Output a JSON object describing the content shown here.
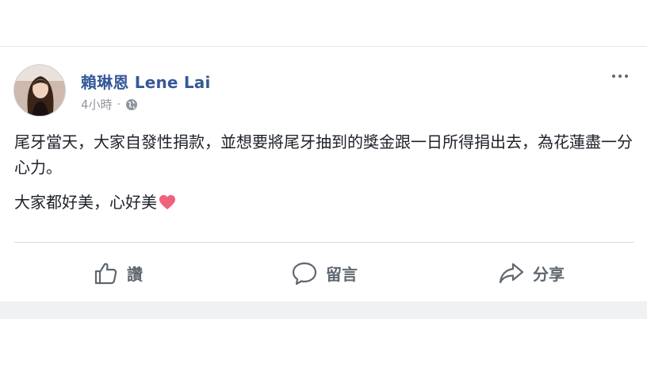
{
  "post": {
    "author_name": "賴琳恩 Lene Lai",
    "timestamp": "4小時",
    "separator": "·",
    "privacy_icon": "globe-icon",
    "more_icon": "more-options-icon",
    "paragraphs": [
      "尾牙當天，大家自發性捐款，並想要將尾牙抽到的獎金跟一日所得捐出去，為花蓮盡一分心力。",
      "大家都好美，心好美"
    ],
    "emoji": "heart-icon",
    "emoji_color": "#f0627b"
  },
  "actions": {
    "like_label": "讚",
    "comment_label": "留言",
    "share_label": "分享"
  },
  "colors": {
    "name_color": "#365899",
    "text_color": "#1d2129",
    "secondary_color": "#90949c",
    "action_color": "#606770"
  }
}
